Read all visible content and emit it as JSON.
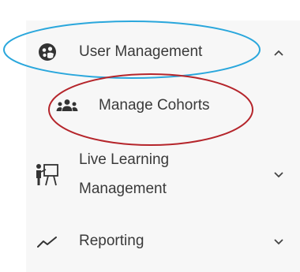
{
  "nav": {
    "user_management": {
      "label": "User Management",
      "icon": "user-group-circle-icon",
      "state": "expanded"
    },
    "manage_cohorts": {
      "label": "Manage Cohorts",
      "icon": "cohort-people-icon"
    },
    "live_learning": {
      "label_line1": "Live Learning",
      "label_line2": "Management",
      "icon": "presenter-board-icon",
      "state": "collapsed"
    },
    "reporting": {
      "label": "Reporting",
      "icon": "trend-line-icon",
      "state": "collapsed"
    }
  },
  "annotations": {
    "blue_ellipse_color": "#2aa7dc",
    "red_ellipse_color": "#b5252b"
  }
}
